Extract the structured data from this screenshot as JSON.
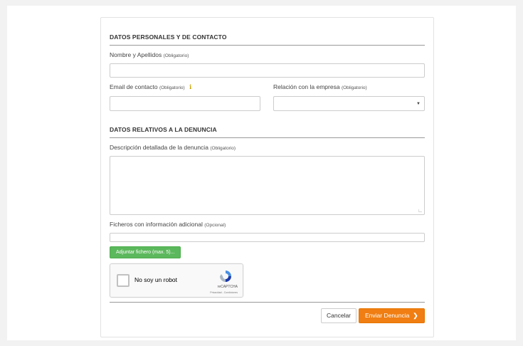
{
  "section_personal": {
    "title": "DATOS PERSONALES Y DE CONTACTO"
  },
  "fields": {
    "name": {
      "label": "Nombre y Apellidos",
      "tag": "(Obligatorio)",
      "value": ""
    },
    "email": {
      "label": "Email de contacto",
      "tag": "(Obligatorio)",
      "value": "",
      "info_icon": "info-icon"
    },
    "relation": {
      "label": "Relación con la empresa",
      "tag": "(Obligatorio)",
      "selected": ""
    },
    "description": {
      "label": "Descripción detallada de la denuncia",
      "tag": "(Obligatorio)",
      "value": ""
    },
    "files": {
      "label": "Ficheros con información adicional",
      "tag": "(Opcional)",
      "value": ""
    }
  },
  "section_complaint": {
    "title": "DATOS RELATIVOS A LA DENUNCIA"
  },
  "attach_button": {
    "label": "Adjuntar fichero (max. 5)..."
  },
  "captcha": {
    "label": "No soy un robot",
    "brand": "reCAPTCHA",
    "terms": "Privacidad - Condiciones"
  },
  "actions": {
    "cancel_label": "Cancelar",
    "submit_label": "Enviar Denuncia",
    "submit_icon": "chevron-right-icon"
  },
  "colors": {
    "submit": "#f07e12",
    "attach": "#5cb85c"
  }
}
